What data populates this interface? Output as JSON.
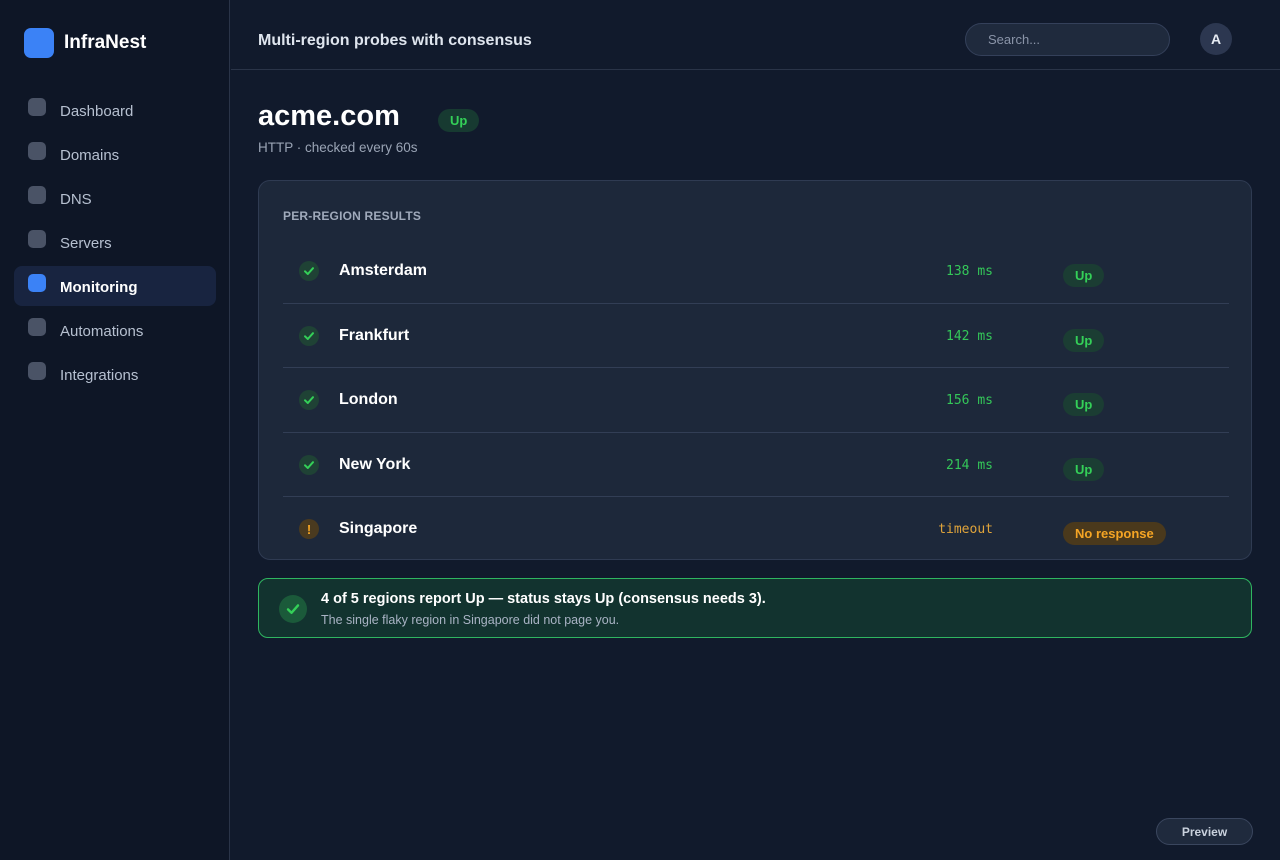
{
  "brand": {
    "name": "InfraNest",
    "accent": "#3b82f6"
  },
  "sidebar": {
    "items": [
      {
        "label": "Dashboard",
        "active": false
      },
      {
        "label": "Domains",
        "active": false
      },
      {
        "label": "DNS",
        "active": false
      },
      {
        "label": "Servers",
        "active": false
      },
      {
        "label": "Monitoring",
        "active": true
      },
      {
        "label": "Automations",
        "active": false
      },
      {
        "label": "Integrations",
        "active": false
      }
    ]
  },
  "header": {
    "title": "Multi-region probes with consensus",
    "search_placeholder": "Search...",
    "avatar_initial": "A"
  },
  "main": {
    "domain": "acme.com",
    "status": "Up",
    "subtitle": "HTTP · checked every 60s",
    "card_label": "PER-REGION RESULTS",
    "regions": [
      {
        "name": "Amsterdam",
        "latency": "138 ms",
        "status": "Up",
        "state": "ok",
        "icon": "check-icon"
      },
      {
        "name": "Frankfurt",
        "latency": "142 ms",
        "status": "Up",
        "state": "ok",
        "icon": "check-icon"
      },
      {
        "name": "London",
        "latency": "156 ms",
        "status": "Up",
        "state": "ok",
        "icon": "check-icon"
      },
      {
        "name": "New York",
        "latency": "214 ms",
        "status": "Up",
        "state": "ok",
        "icon": "check-icon"
      },
      {
        "name": "Singapore",
        "latency": "timeout",
        "status": "No response",
        "state": "warn",
        "icon": "warning-icon"
      }
    ],
    "consensus": {
      "title": "4 of 5 regions report Up — status stays Up (consensus needs 3).",
      "subtitle": "The single flaky region in Singapore did not page you."
    }
  },
  "footer": {
    "preview_label": "Preview"
  },
  "colors": {
    "up": "#34d058",
    "warn": "#f5a524",
    "background": "#111a2c",
    "sidebar": "#0e1626",
    "card": "#1d283a"
  }
}
